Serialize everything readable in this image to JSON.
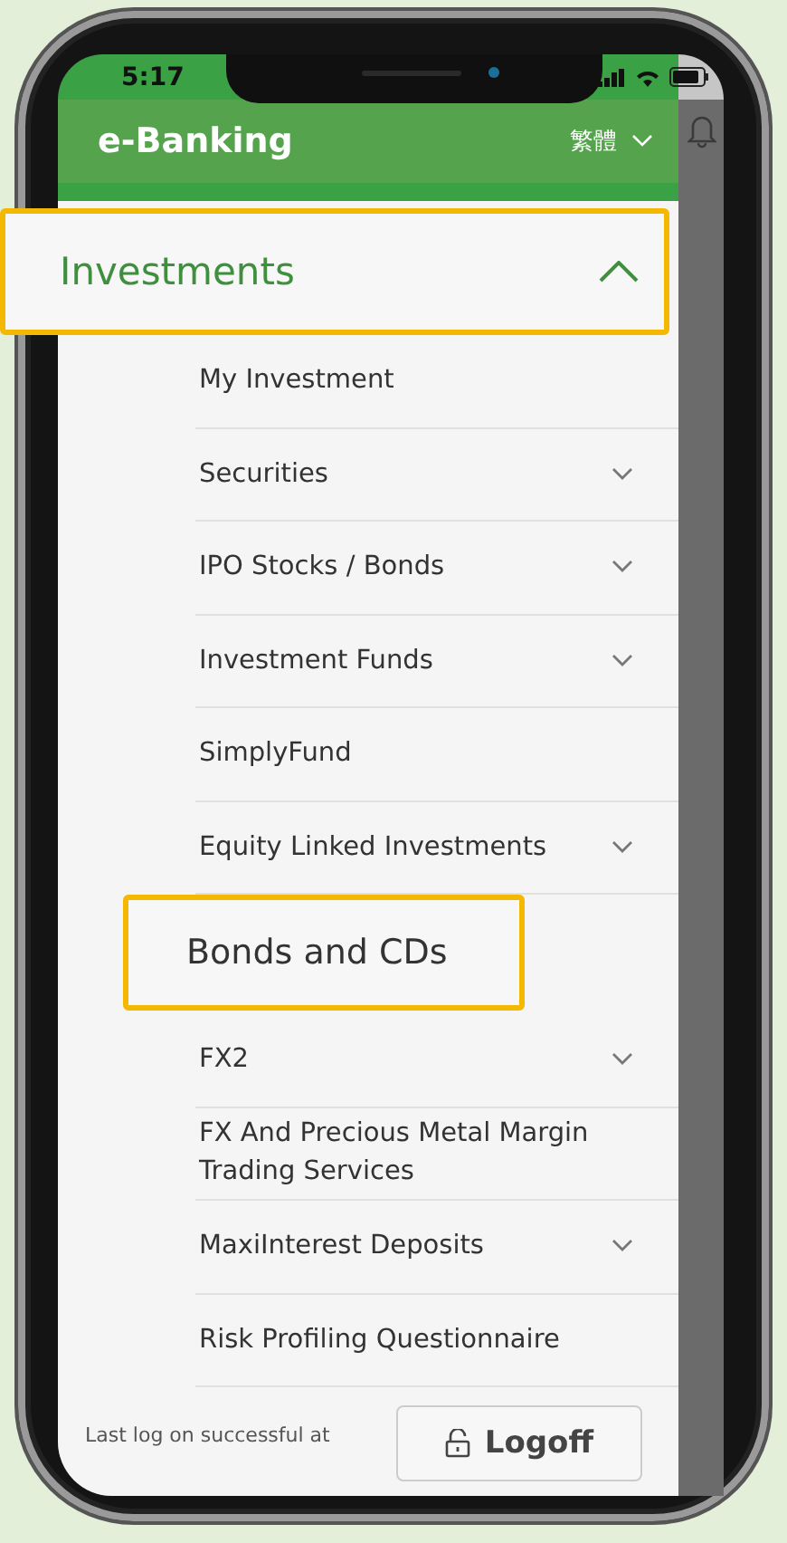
{
  "status_bar": {
    "time": "5:17"
  },
  "header": {
    "title": "e-Banking",
    "language": "繁體"
  },
  "menu": {
    "label": "Investments",
    "expanded": true,
    "highlighted": true,
    "children": [
      {
        "label": "My Investment",
        "has_submenu": false,
        "highlighted": false
      },
      {
        "label": "Securities",
        "has_submenu": true,
        "highlighted": false
      },
      {
        "label": "IPO Stocks / Bonds",
        "has_submenu": true,
        "highlighted": false
      },
      {
        "label": "Investment Funds",
        "has_submenu": true,
        "highlighted": false
      },
      {
        "label": "SimplyFund",
        "has_submenu": false,
        "highlighted": false
      },
      {
        "label": "Equity Linked Investments",
        "has_submenu": true,
        "highlighted": false
      },
      {
        "label": "Bonds and CDs",
        "has_submenu": false,
        "highlighted": true
      },
      {
        "label": "FX2",
        "has_submenu": true,
        "highlighted": false
      },
      {
        "label": "FX And Precious Metal Margin Trading Services",
        "has_submenu": false,
        "highlighted": false
      },
      {
        "label": "MaxiInterest Deposits",
        "has_submenu": true,
        "highlighted": false
      },
      {
        "label": "Risk Profiling Questionnaire",
        "has_submenu": false,
        "highlighted": false
      }
    ]
  },
  "footer": {
    "last_logon": "Last log on successful at",
    "logoff_button": "Logoff"
  }
}
